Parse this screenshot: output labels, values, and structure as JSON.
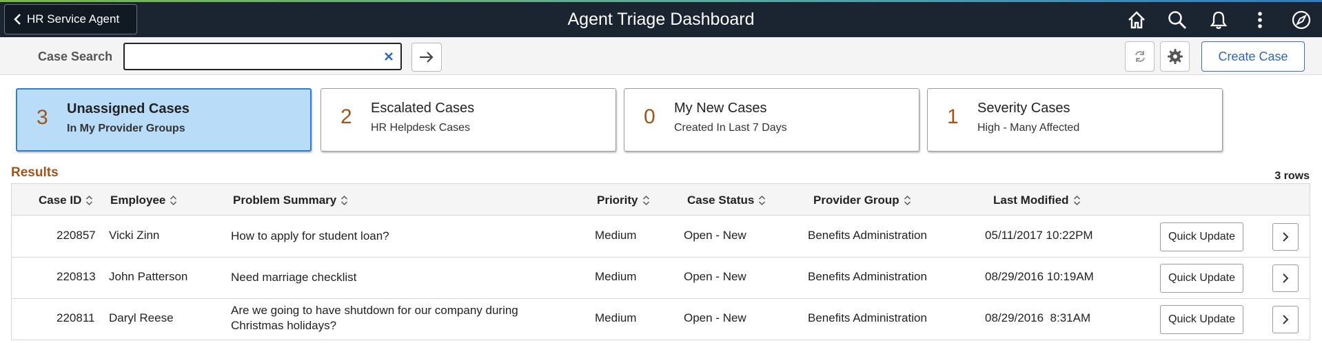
{
  "header": {
    "back_label": "HR Service Agent",
    "title": "Agent Triage Dashboard",
    "icons": [
      "home-icon",
      "search-icon",
      "bell-icon",
      "kebab-menu-icon",
      "navbar-compass-icon"
    ]
  },
  "search": {
    "label": "Case Search",
    "value": "",
    "placeholder": "",
    "create_label": "Create Case"
  },
  "tiles": [
    {
      "count": "3",
      "title": "Unassigned Cases",
      "subtitle": "In My Provider Groups",
      "selected": true
    },
    {
      "count": "2",
      "title": "Escalated Cases",
      "subtitle": "HR Helpdesk Cases",
      "selected": false
    },
    {
      "count": "0",
      "title": "My New Cases",
      "subtitle": "Created In Last 7 Days",
      "selected": false
    },
    {
      "count": "1",
      "title": "Severity Cases",
      "subtitle": "High - Many Affected",
      "selected": false
    }
  ],
  "results": {
    "title": "Results",
    "row_count": "3 rows",
    "columns": [
      "Case ID",
      "Employee",
      "Problem Summary",
      "Priority",
      "Case Status",
      "Provider Group",
      "Last Modified"
    ],
    "action_label": "Quick Update",
    "rows": [
      {
        "case_id": "220857",
        "employee": "Vicki Zinn",
        "summary": "How to apply for student loan?",
        "priority": "Medium",
        "status": "Open - New",
        "provider_group": "Benefits Administration",
        "last_modified": "05/11/2017 10:22PM"
      },
      {
        "case_id": "220813",
        "employee": "John Patterson",
        "summary": "Need marriage checklist",
        "priority": "Medium",
        "status": "Open - New",
        "provider_group": "Benefits Administration",
        "last_modified": "08/29/2016 10:19AM"
      },
      {
        "case_id": "220811",
        "employee": "Daryl Reese",
        "summary": "Are we going to have shutdown for our company during Christmas holidays?",
        "priority": "Medium",
        "status": "Open - New",
        "provider_group": "Benefits Administration",
        "last_modified": "08/29/2016  8:31AM"
      }
    ]
  },
  "colors": {
    "header_bg": "#1b2431",
    "accent": "#2f7cd0",
    "count_color": "#a0541a",
    "selected_tile_bg": "#b9dcf8",
    "link_blue": "#2f67b2"
  }
}
